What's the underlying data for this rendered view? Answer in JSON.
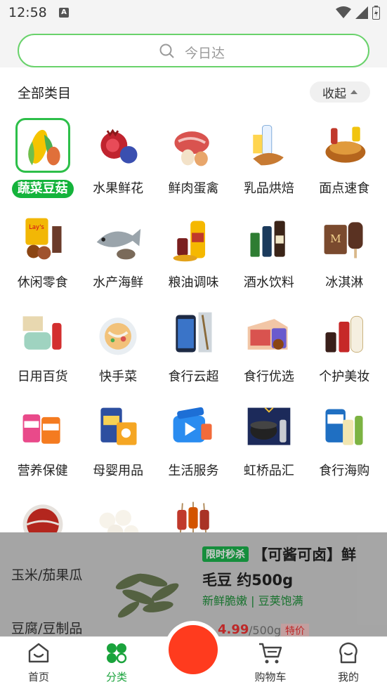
{
  "status_bar": {
    "time": "12:58",
    "a_badge": "A"
  },
  "search": {
    "placeholder": "今日达"
  },
  "panel": {
    "title": "全部类目",
    "collapse_label": "收起",
    "categories": [
      {
        "label": "蔬菜豆菇",
        "icon": "corn-vegetables-icon",
        "selected": true
      },
      {
        "label": "水果鲜花",
        "icon": "pomegranate-fruit-icon"
      },
      {
        "label": "鲜肉蛋禽",
        "icon": "meat-eggs-icon"
      },
      {
        "label": "乳品烘焙",
        "icon": "milk-bread-icon"
      },
      {
        "label": "面点速食",
        "icon": "noodle-snack-icon"
      },
      {
        "label": "休闲零食",
        "icon": "chips-snack-icon"
      },
      {
        "label": "水产海鲜",
        "icon": "fish-seafood-icon"
      },
      {
        "label": "粮油调味",
        "icon": "oil-condiment-icon"
      },
      {
        "label": "酒水饮料",
        "icon": "beverage-bottles-icon"
      },
      {
        "label": "冰淇淋",
        "icon": "ice-cream-icon"
      },
      {
        "label": "日用百货",
        "icon": "household-goods-icon"
      },
      {
        "label": "快手菜",
        "icon": "quick-dish-icon"
      },
      {
        "label": "食行云超",
        "icon": "phone-supermarket-icon"
      },
      {
        "label": "食行优选",
        "icon": "selected-goods-icon"
      },
      {
        "label": "个护美妆",
        "icon": "cosmetics-icon"
      },
      {
        "label": "营养保健",
        "icon": "supplements-icon"
      },
      {
        "label": "母婴用品",
        "icon": "baby-products-icon"
      },
      {
        "label": "生活服务",
        "icon": "life-service-icon"
      },
      {
        "label": "虹桥品汇",
        "icon": "cooker-goods-icon"
      },
      {
        "label": "食行海购",
        "icon": "overseas-goods-icon"
      },
      {
        "label": "",
        "icon": "hotpot-icon"
      },
      {
        "label": "",
        "icon": "dumplings-icon"
      },
      {
        "label": "",
        "icon": "skewers-icon"
      }
    ]
  },
  "background": {
    "sidebar": [
      "玉米/茄果瓜",
      "豆腐/豆制品"
    ],
    "product": {
      "tag": "限时秒杀",
      "title_line1": "【可酱可卤】鲜",
      "title_line2": "毛豆 约500g",
      "subtitle": "新鲜脆嫩 | 豆荚饱满",
      "price": "4.99",
      "unit": "/500g",
      "special": "特价"
    }
  },
  "tabbar": {
    "tabs": [
      {
        "label": "首页",
        "icon": "home-icon"
      },
      {
        "label": "分类",
        "icon": "category-icon",
        "active": true
      },
      {
        "label": "购物车",
        "icon": "cart-icon"
      },
      {
        "label": "我的",
        "icon": "profile-icon"
      }
    ]
  },
  "colors": {
    "accent": "#14b33b",
    "search_border": "#69d26b",
    "fab": "#ff3b1e"
  }
}
